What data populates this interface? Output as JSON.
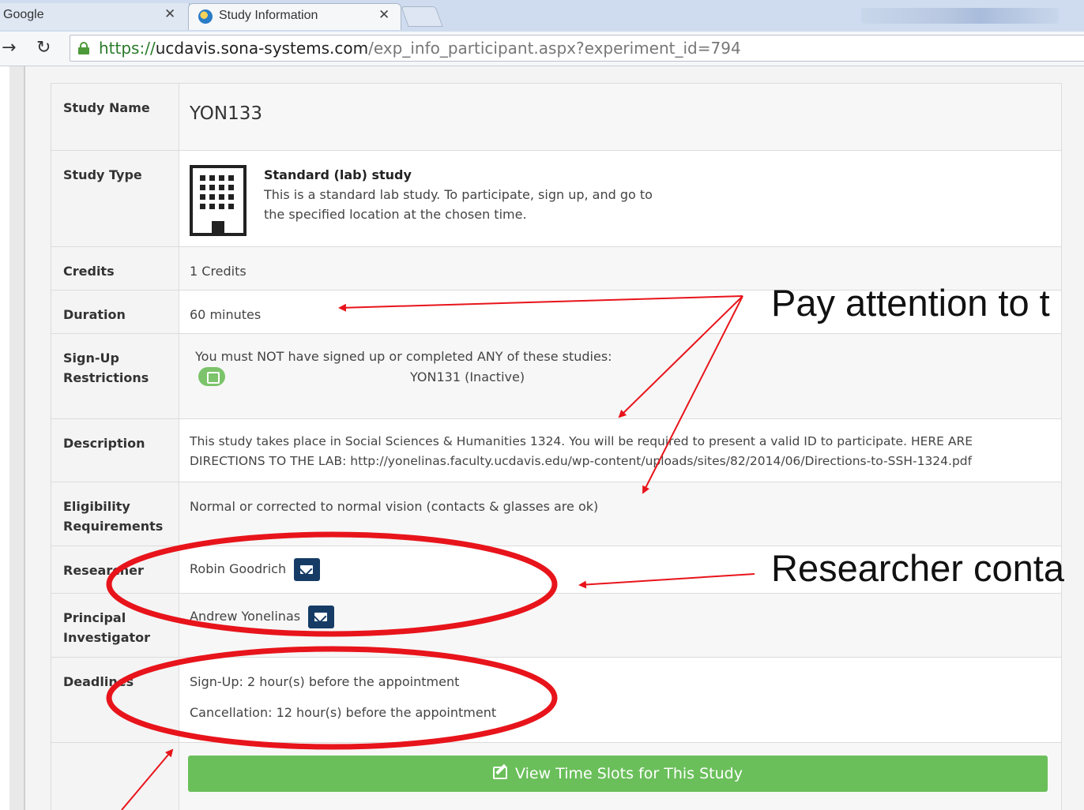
{
  "browser": {
    "tabs": [
      {
        "label": "Google",
        "active": false
      },
      {
        "label": "Study Information",
        "active": true
      }
    ],
    "url": {
      "scheme": "https://",
      "host": "ucdavis.sona-systems.com",
      "path": "/exp_info_participant.aspx?experiment_id=794"
    },
    "icons": {
      "back": "forward-arrow-icon",
      "reload": "reload-icon",
      "lock": "lock-icon",
      "close": "close-icon"
    }
  },
  "study": {
    "name_label": "Study Name",
    "name": "YON133",
    "type_label": "Study Type",
    "type_title": "Standard (lab) study",
    "type_desc_1": "This is a standard lab study. To participate, sign up, and go to",
    "type_desc_2": "the specified location at the chosen time.",
    "credits_label": "Credits",
    "credits": "1 Credits",
    "duration_label": "Duration",
    "duration": "60 minutes",
    "signup_label_1": "Sign-Up",
    "signup_label_2": "Restrictions",
    "restriction_text": "You must NOT have signed up or completed ANY of these studies:",
    "restriction_study": "YON131 (Inactive)",
    "description_label": "Description",
    "description": "This study takes place in Social Sciences & Humanities 1324. You will be required to present a valid ID to participate. HERE ARE DIRECTIONS TO THE LAB: http://yonelinas.faculty.ucdavis.edu/wp-content/uploads/sites/82/2014/06/Directions-to-SSH-1324.pdf",
    "eligibility_label_1": "Eligibility",
    "eligibility_label_2": "Requirements",
    "eligibility": "Normal or corrected to normal vision (contacts & glasses are ok)",
    "researcher_label": "Researcher",
    "researcher": "Robin Goodrich",
    "pi_label_1": "Principal",
    "pi_label_2": "Investigator",
    "pi": "Andrew Yonelinas",
    "deadlines_label": "Deadlines",
    "deadline_signup": "Sign-Up:  2 hour(s) before the appointment",
    "deadline_cancel": "Cancellation:  12 hour(s) before the appointment",
    "view_button": "View Time Slots for This Study"
  },
  "annotations": {
    "note_1": "Pay attention to t",
    "note_2": "Researcher conta",
    "color": "#e8141b"
  }
}
